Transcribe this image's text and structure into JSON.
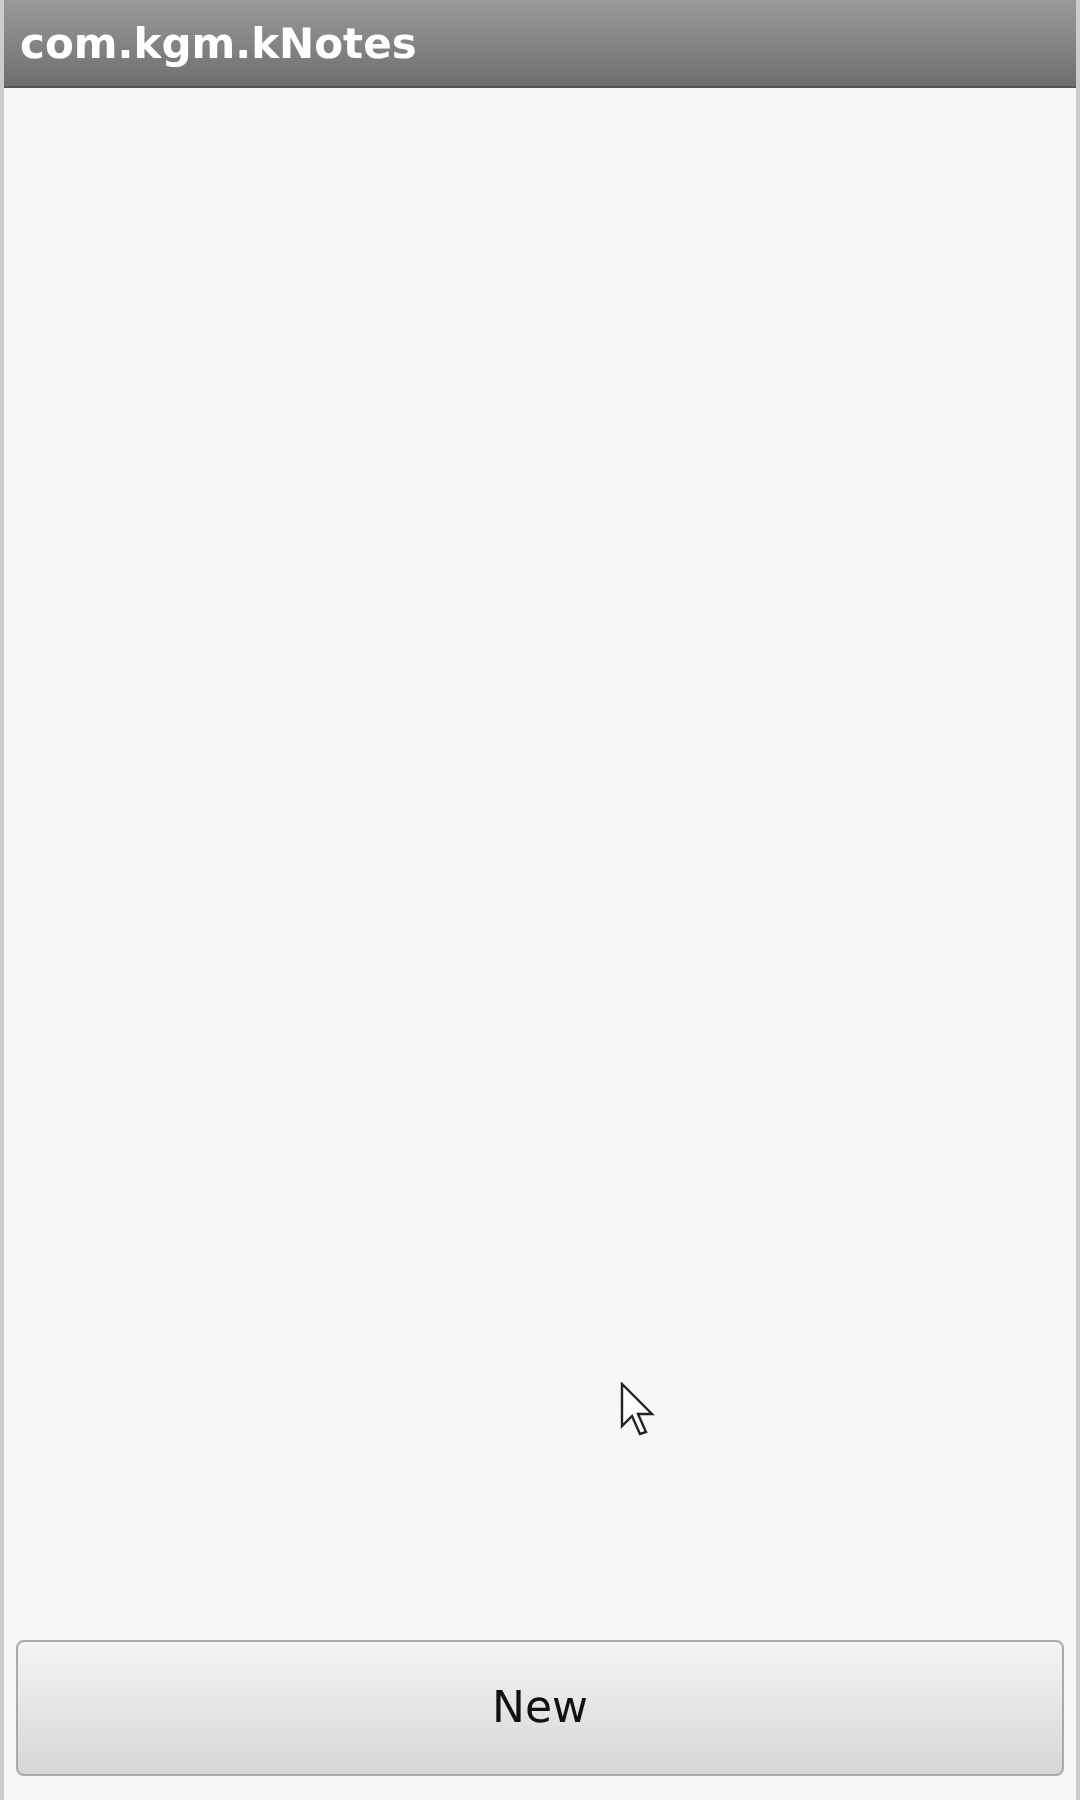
{
  "window": {
    "title": "com.kgm.kNotes"
  },
  "buttons": [
    {
      "label": "New"
    }
  ]
}
